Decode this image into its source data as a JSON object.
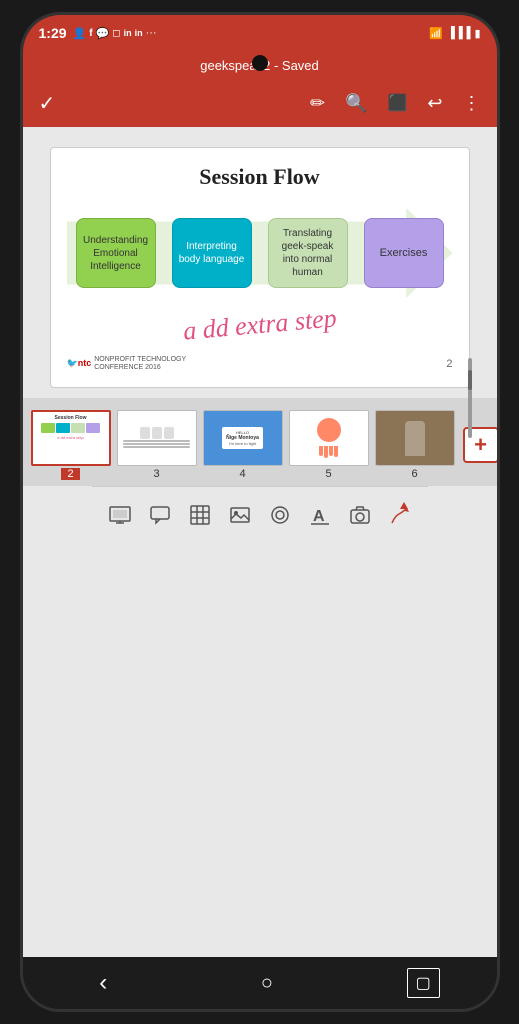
{
  "statusBar": {
    "time": "1:29",
    "icons": [
      "👤",
      "f",
      "💬",
      "◻",
      "in",
      "in",
      "···"
    ],
    "rightIcons": [
      "wifi",
      "signal",
      "battery"
    ]
  },
  "titleBar": {
    "text": "geekspeak2 - Saved"
  },
  "toolbar": {
    "checkmark": "✓",
    "icons": [
      "✏",
      "🔍",
      "⬜",
      "↩",
      "⋮"
    ]
  },
  "slide": {
    "title": "Session Flow",
    "boxes": [
      {
        "label": "Understanding Emotional Intelligence",
        "color": "green"
      },
      {
        "label": "Interpreting body language",
        "color": "teal"
      },
      {
        "label": "Translating geek-speak into normal human",
        "color": "lime"
      },
      {
        "label": "Exercises",
        "color": "purple"
      }
    ],
    "handwriting": "a dd extra step",
    "slideNumber": "2",
    "logoText": "NONPROFIT TECHNOLOGY\nCONFERENCE 2016"
  },
  "thumbnails": [
    {
      "number": "2",
      "active": true
    },
    {
      "number": "3",
      "active": false
    },
    {
      "number": "4",
      "active": false
    },
    {
      "number": "5",
      "active": false
    },
    {
      "number": "6",
      "active": false
    }
  ],
  "bottomToolbar": {
    "icons": [
      "slides",
      "comment",
      "table",
      "image",
      "shape",
      "text",
      "camera",
      "ink"
    ]
  },
  "navigation": {
    "back": "‹",
    "home": "○",
    "recent": "▢"
  }
}
